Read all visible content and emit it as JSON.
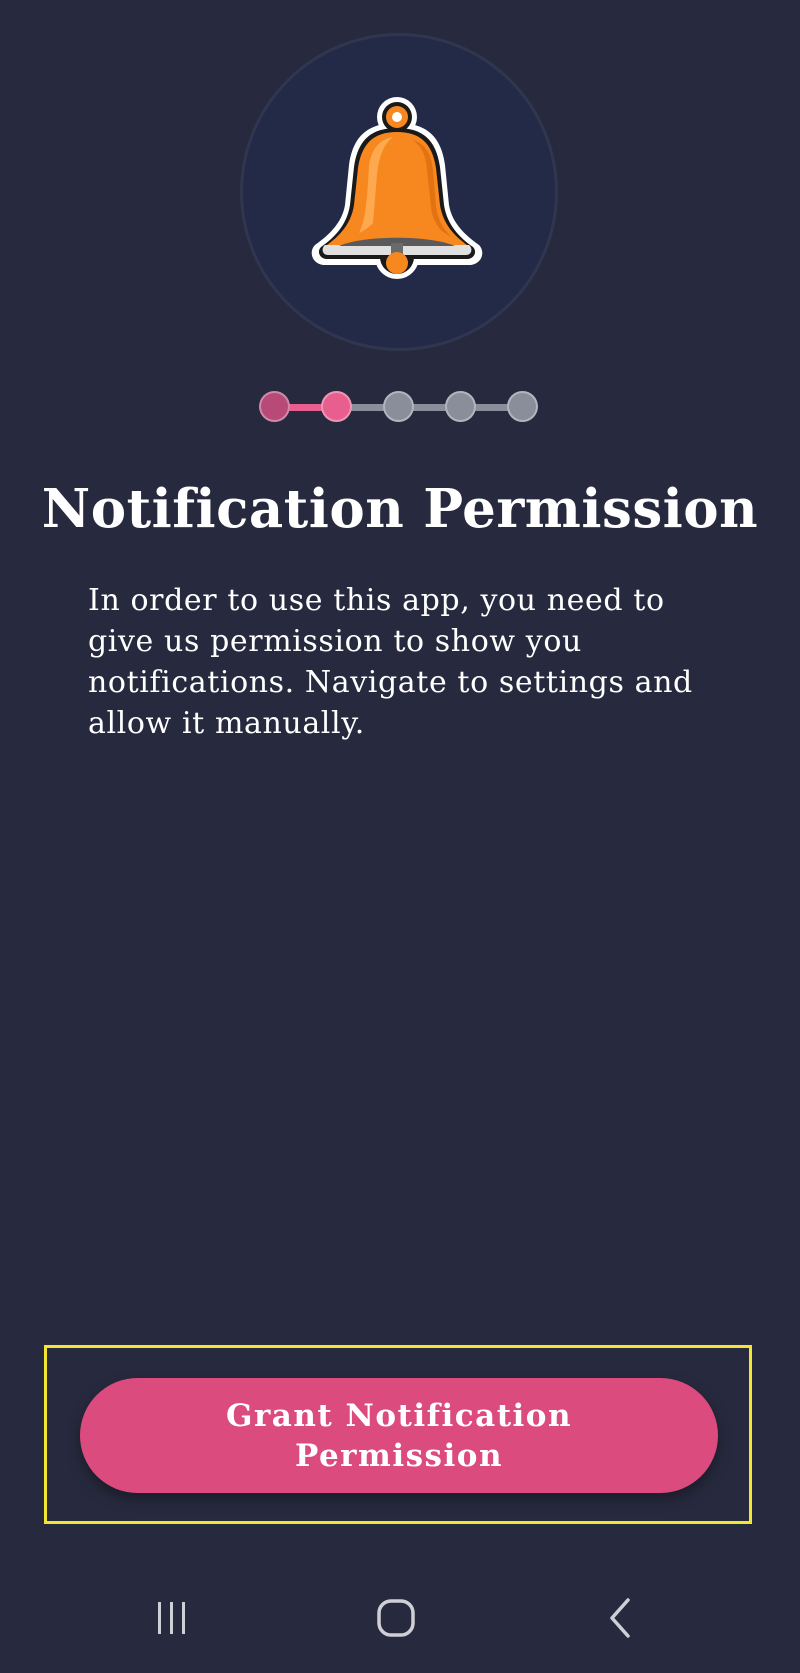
{
  "onboarding": {
    "title": "Notification Permission",
    "description": "In order to use this app, you need to give us permission to show you notifications. Navigate to settings and allow it manually.",
    "cta_label": "Grant Notification Permission",
    "steps": {
      "total": 5,
      "current": 2
    }
  },
  "icons": {
    "hero": "bell-icon",
    "recent_apps": "recent-apps-icon",
    "home": "home-icon",
    "back": "back-icon"
  },
  "colors": {
    "background": "#272a3e",
    "accent": "#dc4b7d",
    "bell": "#f7871f",
    "step_active": "#e85e8e",
    "step_inactive": "#8a8d9a",
    "highlight_frame": "#f2e630"
  }
}
